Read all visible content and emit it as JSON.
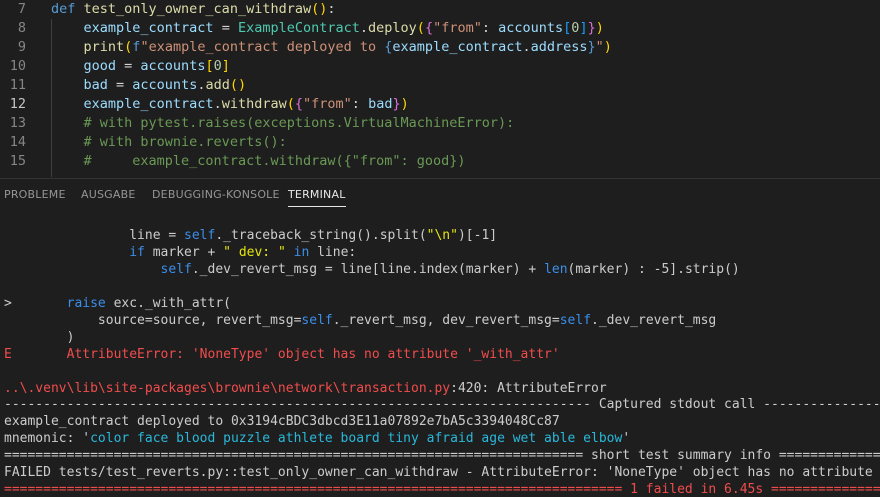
{
  "editor": {
    "lines": [
      {
        "num": "7",
        "segments": [
          [
            "kw",
            "def "
          ],
          [
            "fn",
            "test_only_owner_can_withdraw"
          ],
          [
            "brk3",
            "("
          ],
          [
            "brk3",
            ")"
          ],
          [
            "txt",
            ":"
          ]
        ]
      },
      {
        "num": "8",
        "segments": [
          [
            "txt",
            "    "
          ],
          [
            "var",
            "example_contract"
          ],
          [
            "txt",
            " = "
          ],
          [
            "cls",
            "ExampleContract"
          ],
          [
            "txt",
            "."
          ],
          [
            "fn",
            "deploy"
          ],
          [
            "brk3",
            "("
          ],
          [
            "brk",
            "{"
          ],
          [
            "str",
            "\"from\""
          ],
          [
            "txt",
            ": "
          ],
          [
            "var",
            "accounts"
          ],
          [
            "brk2",
            "["
          ],
          [
            "num",
            "0"
          ],
          [
            "brk2",
            "]"
          ],
          [
            "brk",
            "}"
          ],
          [
            "brk3",
            ")"
          ]
        ]
      },
      {
        "num": "9",
        "segments": [
          [
            "txt",
            "    "
          ],
          [
            "fn",
            "print"
          ],
          [
            "brk3",
            "("
          ],
          [
            "kw",
            "f"
          ],
          [
            "str",
            "\"example_contract deployed to "
          ],
          [
            "kw",
            "{"
          ],
          [
            "var",
            "example_contract"
          ],
          [
            "txt",
            "."
          ],
          [
            "var",
            "address"
          ],
          [
            "kw",
            "}"
          ],
          [
            "str",
            "\""
          ],
          [
            "brk3",
            ")"
          ]
        ]
      },
      {
        "num": "10",
        "segments": [
          [
            "txt",
            "    "
          ],
          [
            "var",
            "good"
          ],
          [
            "txt",
            " = "
          ],
          [
            "var",
            "accounts"
          ],
          [
            "brk3",
            "["
          ],
          [
            "num",
            "0"
          ],
          [
            "brk3",
            "]"
          ]
        ]
      },
      {
        "num": "11",
        "segments": [
          [
            "txt",
            "    "
          ],
          [
            "var",
            "bad"
          ],
          [
            "txt",
            " = "
          ],
          [
            "var",
            "accounts"
          ],
          [
            "txt",
            "."
          ],
          [
            "fn",
            "add"
          ],
          [
            "brk3",
            "("
          ],
          [
            "brk3",
            ")"
          ]
        ]
      },
      {
        "num": "12",
        "segments": [
          [
            "txt",
            "    "
          ],
          [
            "var",
            "example_contract"
          ],
          [
            "txt",
            "."
          ],
          [
            "fn",
            "withdraw"
          ],
          [
            "brk3",
            "("
          ],
          [
            "brk",
            "{"
          ],
          [
            "str",
            "\"from\""
          ],
          [
            "txt",
            ": "
          ],
          [
            "var",
            "bad"
          ],
          [
            "brk",
            "}"
          ],
          [
            "brk3",
            ")"
          ]
        ],
        "active": true
      },
      {
        "num": "13",
        "segments": [
          [
            "txt",
            "    "
          ],
          [
            "cmt",
            "# with pytest.raises(exceptions.VirtualMachineError):"
          ]
        ]
      },
      {
        "num": "14",
        "segments": [
          [
            "txt",
            "    "
          ],
          [
            "cmt",
            "# with brownie.reverts():"
          ]
        ]
      },
      {
        "num": "15",
        "segments": [
          [
            "txt",
            "    "
          ],
          [
            "cmt",
            "#     example_contract.withdraw({\"from\": good})"
          ]
        ]
      }
    ]
  },
  "panel": {
    "tabs": [
      {
        "label": "PROBLEME",
        "active": false
      },
      {
        "label": "AUSGABE",
        "active": false
      },
      {
        "label": "DEBUGGING-KONSOLE",
        "active": false
      },
      {
        "label": "TERMINAL",
        "active": true
      }
    ]
  },
  "terminal": {
    "lines": [
      {
        "segments": [
          [
            "txt",
            "                line = "
          ],
          [
            "blue",
            "self"
          ],
          [
            "txt",
            "._traceback_string().split("
          ],
          [
            "yel",
            "\"\\n\""
          ],
          [
            "txt",
            ")[-"
          ],
          [
            "txt",
            "1]"
          ]
        ]
      },
      {
        "segments": [
          [
            "txt",
            "                "
          ],
          [
            "blue",
            "if"
          ],
          [
            "txt",
            " marker + "
          ],
          [
            "yel",
            "\" dev: \""
          ],
          [
            "txt",
            " "
          ],
          [
            "blue",
            "in"
          ],
          [
            "txt",
            " line:"
          ]
        ]
      },
      {
        "segments": [
          [
            "txt",
            "                    "
          ],
          [
            "blue",
            "self"
          ],
          [
            "txt",
            "._dev_revert_msg = line[line.index(marker) + "
          ],
          [
            "blue",
            "len"
          ],
          [
            "txt",
            "(marker) : -"
          ],
          [
            "txt",
            "5].strip()"
          ]
        ]
      },
      {
        "segments": [
          [
            "txt",
            ""
          ]
        ]
      },
      {
        "segments": [
          [
            "txt",
            ">       "
          ],
          [
            "blue",
            "raise"
          ],
          [
            "txt",
            " exc._with_attr("
          ]
        ]
      },
      {
        "segments": [
          [
            "txt",
            "            source=source, revert_msg="
          ],
          [
            "blue",
            "self"
          ],
          [
            "txt",
            "._revert_msg, dev_revert_msg="
          ],
          [
            "blue",
            "self"
          ],
          [
            "txt",
            "._dev_revert_msg"
          ]
        ]
      },
      {
        "segments": [
          [
            "txt",
            "        )"
          ]
        ]
      },
      {
        "segments": [
          [
            "red",
            "E       AttributeError: 'NoneType' object has no attribute '_with_attr'"
          ]
        ]
      },
      {
        "segments": [
          [
            "txt",
            ""
          ]
        ]
      },
      {
        "segments": [
          [
            "red",
            "..\\.venv\\lib\\site-packages\\brownie\\network\\transaction.py"
          ],
          [
            "txt",
            ":420: AttributeError"
          ]
        ]
      },
      {
        "segments": [
          [
            "sep",
            "--------------------------------------------------------------------------- Captured stdout call ----------------------"
          ]
        ]
      },
      {
        "segments": [
          [
            "txt",
            "example_contract deployed to 0x3194cBDC3dbcd3E11a07892e7bA5c3394048Cc87"
          ]
        ]
      },
      {
        "segments": [
          [
            "txt",
            "mnemonic: '"
          ],
          [
            "cyan",
            "color face blood puzzle athlete board tiny afraid age wet able elbow"
          ],
          [
            "txt",
            "'"
          ]
        ]
      },
      {
        "segments": [
          [
            "sep",
            "========================================================================== short test summary info ====================="
          ]
        ]
      },
      {
        "segments": [
          [
            "txt",
            "FAILED tests/test_reverts.py::test_only_owner_can_withdraw - AttributeError: 'NoneType' object has no attribute '_with_attr'"
          ]
        ]
      },
      {
        "segments": [
          [
            "red",
            "=============================================================================== 1 failed in 6.45s ==================="
          ]
        ]
      }
    ]
  }
}
